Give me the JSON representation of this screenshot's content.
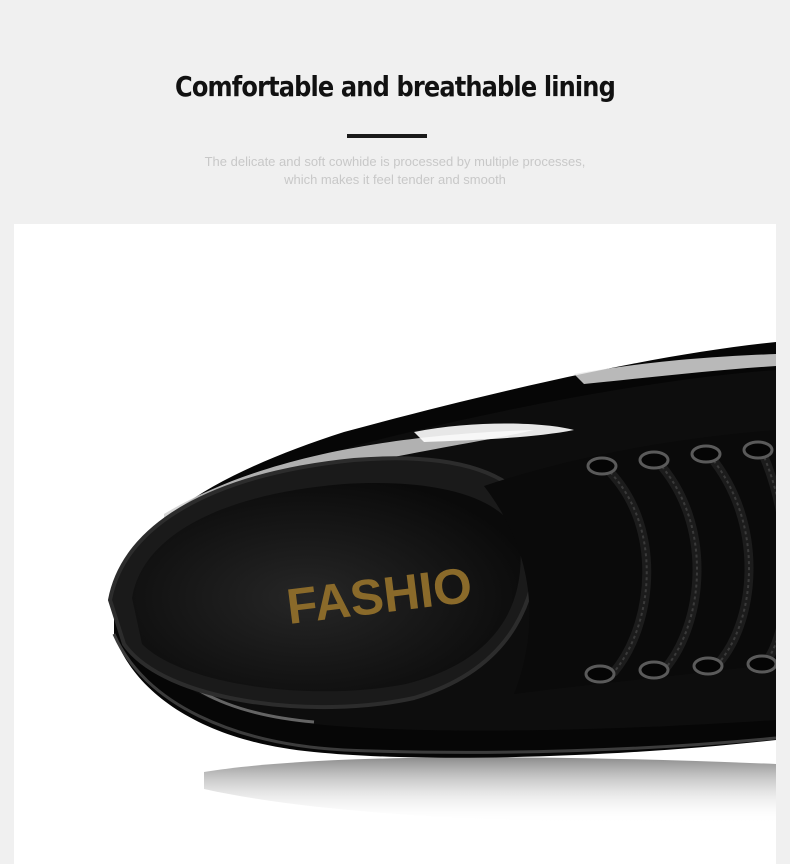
{
  "header": {
    "title": "Comfortable and breathable lining",
    "subtitle_line1": "The delicate and soft cowhide is processed by multiple processes,",
    "subtitle_line2": "which makes it feel tender and smooth"
  },
  "product": {
    "insole_brand": "FASHIO",
    "colors": {
      "leather": "#0b0b0b",
      "insole_text": "#8a6a2a",
      "background": "#f0f0f0"
    }
  }
}
